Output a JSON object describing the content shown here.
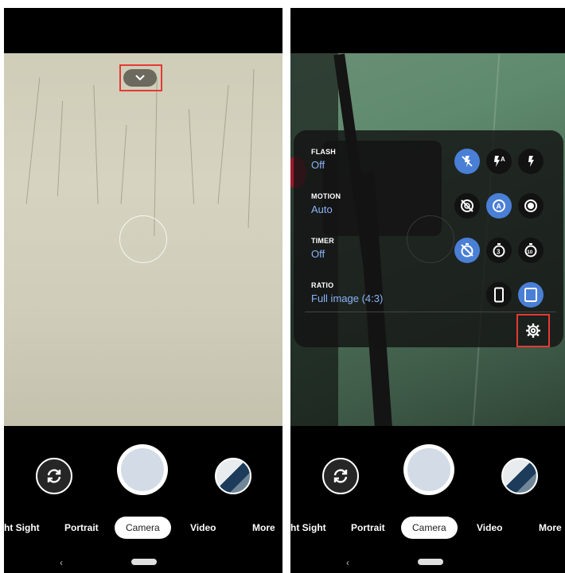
{
  "modes": [
    "ht Sight",
    "Portrait",
    "Camera",
    "Video",
    "More"
  ],
  "nav": {
    "back_glyph": "‹"
  },
  "quick_settings": {
    "flash": {
      "label": "FLASH",
      "value": "Off",
      "options": [
        "flash-off-icon",
        "flash-auto-icon",
        "flash-on-icon"
      ],
      "selected": 0
    },
    "motion": {
      "label": "MOTION",
      "value": "Auto",
      "options": [
        "motion-off-icon",
        "motion-auto-icon",
        "motion-on-icon"
      ],
      "selected": 1
    },
    "timer": {
      "label": "TIMER",
      "value": "Off",
      "options": [
        "timer-off-icon",
        "timer-3s-icon",
        "timer-10s-icon"
      ],
      "selected": 0
    },
    "ratio": {
      "label": "RATIO",
      "value": "Full image (4:3)",
      "options": [
        "ratio-16-9-icon",
        "ratio-4-3-icon"
      ],
      "selected": 1
    }
  },
  "colors": {
    "accent": "#4a7fd6",
    "value_text": "#8ab4f8",
    "highlight": "#e53935"
  }
}
